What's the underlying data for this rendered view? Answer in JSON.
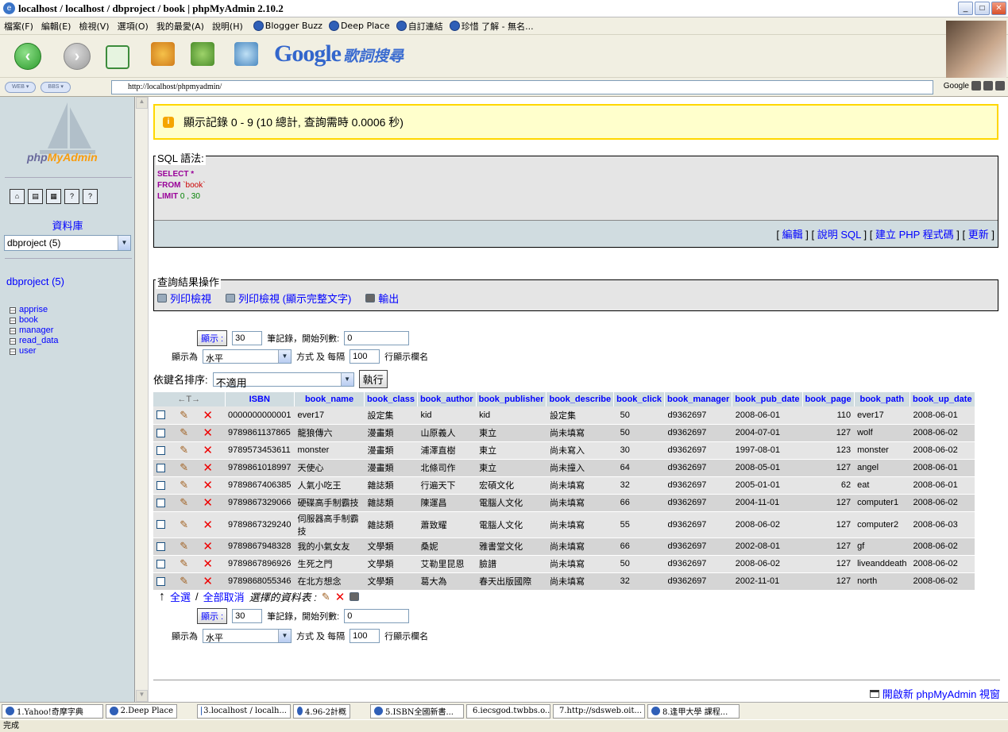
{
  "window": {
    "title": "localhost / localhost / dbproject / book | phpMyAdmin 2.10.2"
  },
  "menu": {
    "items": [
      "檔案(F)",
      "編輯(E)",
      "檢視(V)",
      "選項(O)",
      "我的最愛(A)",
      "說明(H)"
    ],
    "favorites": [
      "Blogger Buzz",
      "Deep Place",
      "自訂連結",
      "珍惜 了解 - 無名..."
    ]
  },
  "toolbar": {
    "google": "Google",
    "lyrics": "歌詞搜尋"
  },
  "addressbar": {
    "pill1": "WEB ▾",
    "pill2": "BBS ▾",
    "url": "http://localhost/phpmyadmin/",
    "google_label": "Google"
  },
  "sidebar": {
    "logo_php": "php",
    "logo_my": "MyAdmin",
    "db_label": "資料庫",
    "db_select": "dbproject (5)",
    "db_name": "dbproject (5)",
    "tables": [
      "apprise",
      "book",
      "manager",
      "read_data",
      "user"
    ]
  },
  "notice": {
    "text": "顯示記錄 0 - 9 (10 總計, 查詢需時 0.0006 秒)"
  },
  "sql": {
    "legend": "SQL 語法:",
    "line1_kw": "SELECT",
    "line1_rest": " *",
    "line2_kw": "FROM",
    "line2_str": " `book`",
    "line3_kw": "LIMIT",
    "line3_num": " 0 , 30",
    "links": [
      "編輯",
      "說明 SQL",
      "建立 PHP 程式碼",
      "更新"
    ]
  },
  "ops": {
    "legend": "查詢結果操作",
    "print": "列印檢視",
    "print_full": "列印檢視 (顯示完整文字)",
    "export": "輸出"
  },
  "nav": {
    "show_btn": "顯示 :",
    "rows": "30",
    "rows_label": "筆記錄，開始列數:",
    "start": "0",
    "mode_label": "顯示為",
    "mode": "水平",
    "mode_label2": "方式 及 每隔",
    "repeat": "100",
    "repeat_label": "行顯示欄名",
    "sort_label": "依鍵名排序:",
    "sort": "不適用",
    "go": "執行"
  },
  "table": {
    "arrows": "←T→",
    "columns": [
      "ISBN",
      "book_name",
      "book_class",
      "book_author",
      "book_publisher",
      "book_describe",
      "book_click",
      "book_manager",
      "book_pub_date",
      "book_page",
      "book_path",
      "book_up_date"
    ],
    "rows": [
      [
        "0000000000001",
        "ever17",
        "設定集",
        "kid",
        "kid",
        "設定集",
        "50",
        "d9362697",
        "2008-06-01",
        "110",
        "ever17",
        "2008-06-01"
      ],
      [
        "9789861137865",
        "龍狼傳六",
        "漫畫類",
        "山原義人",
        "東立",
        "尚未填寫",
        "50",
        "d9362697",
        "2004-07-01",
        "127",
        "wolf",
        "2008-06-02"
      ],
      [
        "9789573453611",
        "monster",
        "漫畫類",
        "浦澤直樹",
        "東立",
        "尚未寫入",
        "30",
        "d9362697",
        "1997-08-01",
        "123",
        "monster",
        "2008-06-02"
      ],
      [
        "9789861018997",
        "天使心",
        "漫畫類",
        "北條司作",
        "東立",
        "尚未撞入",
        "64",
        "d9362697",
        "2008-05-01",
        "127",
        "angel",
        "2008-06-01"
      ],
      [
        "9789867406385",
        "人氣小吃王",
        "雜誌類",
        "行遍天下",
        "宏碩文化",
        "尚未填寫",
        "32",
        "d9362697",
        "2005-01-01",
        "62",
        "eat",
        "2008-06-01"
      ],
      [
        "9789867329066",
        "硬碟高手制霸技",
        "雜誌類",
        "陳運昌",
        "電腦人文化",
        "尚未填寫",
        "66",
        "d9362697",
        "2004-11-01",
        "127",
        "computer1",
        "2008-06-02"
      ],
      [
        "9789867329240",
        "伺服器高手制霸技",
        "雜誌類",
        "蕭致耀",
        "電腦人文化",
        "尚未填寫",
        "55",
        "d9362697",
        "2008-06-02",
        "127",
        "computer2",
        "2008-06-03"
      ],
      [
        "9789867948328",
        "我的小氣女友",
        "文學類",
        "桑妮",
        "雅書堂文化",
        "尚未填寫",
        "66",
        "d9362697",
        "2002-08-01",
        "127",
        "gf",
        "2008-06-02"
      ],
      [
        "9789867896926",
        "生死之門",
        "文學類",
        "艾勒里昆恩",
        "臉譜",
        "尚未填寫",
        "50",
        "d9362697",
        "2008-06-02",
        "127",
        "liveanddeath",
        "2008-06-02"
      ],
      [
        "9789868055346",
        "在北方想念",
        "文學類",
        "葛大為",
        "春天出版國際",
        "尚未填寫",
        "32",
        "d9362697",
        "2002-11-01",
        "127",
        "north",
        "2008-06-02"
      ]
    ]
  },
  "footer": {
    "check_all": "全選",
    "sep": " / ",
    "uncheck_all": "全部取消",
    "selected": "選擇的資料表 :",
    "new_window": "開啟新 phpMyAdmin 視窗"
  },
  "taskbar": [
    "1.Yahoo!奇摩字典",
    "2.Deep Place",
    "3.localhost / localh...",
    "4.96-2計概",
    "5.ISBN全國新書...",
    "6.iecsgod.twbbs.o...",
    "7.http://sdsweb.oit...",
    "8.逢甲大學 課程..."
  ],
  "status": {
    "text": "完成"
  }
}
